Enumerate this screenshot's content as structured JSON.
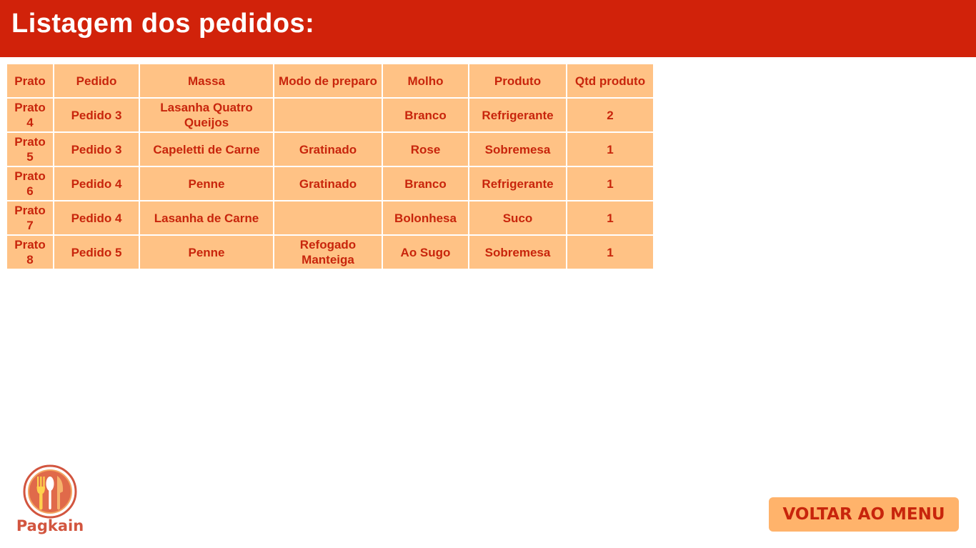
{
  "header": {
    "title": "Listagem dos pedidos:"
  },
  "table": {
    "columns": [
      "Prato",
      "Pedido",
      "Massa",
      "Modo de preparo",
      "Molho",
      "Produto",
      "Qtd produto"
    ],
    "rows": [
      [
        "Prato 4",
        "Pedido 3",
        "Lasanha Quatro Queijos",
        "",
        "Branco",
        "Refrigerante",
        "2"
      ],
      [
        "Prato 5",
        "Pedido 3",
        "Capeletti de Carne",
        "Gratinado",
        "Rose",
        "Sobremesa",
        "1"
      ],
      [
        "Prato 6",
        "Pedido 4",
        "Penne",
        "Gratinado",
        "Branco",
        "Refrigerante",
        "1"
      ],
      [
        "Prato 7",
        "Pedido 4",
        "Lasanha de Carne",
        "",
        "Bolonhesa",
        "Suco",
        "1"
      ],
      [
        "Prato 8",
        "Pedido 5",
        "Penne",
        "Refogado Manteiga",
        "Ao Sugo",
        "Sobremesa",
        "1"
      ]
    ]
  },
  "logo": {
    "text": "Pagkain",
    "icon": "fork-spoon-knife-icon"
  },
  "footer": {
    "menu_button_label": "VOLTAR AO MENU"
  },
  "colors": {
    "header_bg": "#d1220a",
    "cell_bg": "#ffc285",
    "cell_text": "#c8250c",
    "button_bg": "#ffb36b"
  }
}
